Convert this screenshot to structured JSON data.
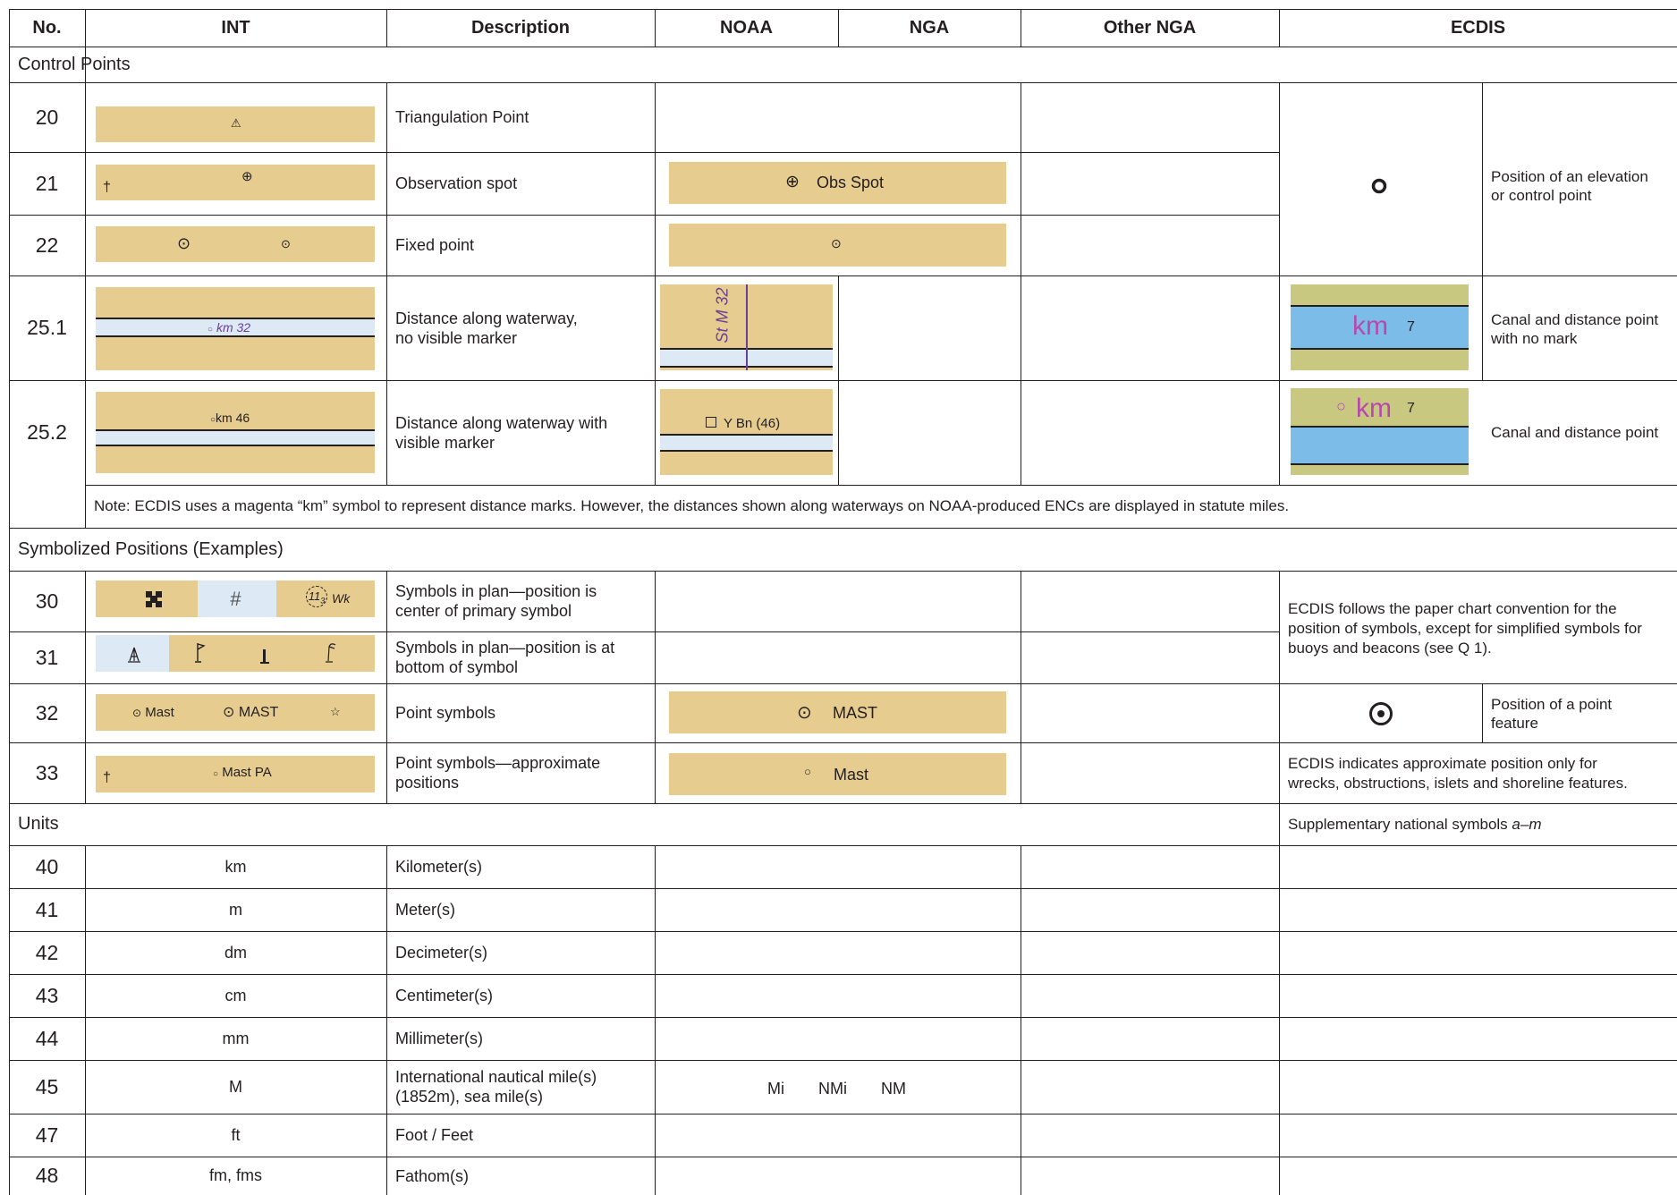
{
  "header": {
    "no": "No.",
    "int": "INT",
    "description": "Description",
    "noaa": "NOAA",
    "nga": "NGA",
    "other_nga": "Other NGA",
    "ecdis": "ECDIS"
  },
  "sections": {
    "control_points": "Control Points",
    "symbolized_positions": "Symbolized Positions (Examples)",
    "units": "Units"
  },
  "rows": {
    "r20": {
      "no": "20",
      "desc": "Triangulation Point",
      "int_symbol": "⚠"
    },
    "r21": {
      "no": "21",
      "desc": "Observation spot",
      "int_cross": "†",
      "int_symbol": "⊕",
      "noaa_symbol": "⊕",
      "noaa_text": "Obs Spot"
    },
    "r22": {
      "no": "22",
      "desc": "Fixed point",
      "int_symbol_a": "⊙",
      "int_symbol_b": "⊙",
      "noaa_symbol": "⊙"
    },
    "r25_1": {
      "no": "25.1",
      "desc_line1": "Distance along waterway,",
      "desc_line2": "no visible marker",
      "int_label": "km 32",
      "noaa_label": "St M 32",
      "ecdis_km": "km",
      "ecdis_num": "7",
      "ecdis_desc_line1": "Canal and distance point",
      "ecdis_desc_line2": "with no mark"
    },
    "r25_2": {
      "no": "25.2",
      "desc_line1": "Distance along waterway with",
      "desc_line2": "visible marker",
      "int_label": "km 46",
      "noaa_label": "Y Bn (46)",
      "ecdis_km": "km",
      "ecdis_num": "7",
      "ecdis_desc": "Canal and distance point"
    },
    "r30": {
      "no": "30",
      "desc_line1": "Symbols in plan—position is",
      "desc_line2": "center of primary symbol",
      "int_hash": "#",
      "int_wreck_num": "11",
      "int_wreck_sub": "3",
      "int_wreck_label": "Wk"
    },
    "r31": {
      "no": "31",
      "desc_line1": "Symbols in plan—position is at",
      "desc_line2": "bottom of symbol"
    },
    "r32": {
      "no": "32",
      "desc": "Point symbols",
      "int_mast_a": "Mast",
      "int_mast_b": "MAST",
      "int_star": "☆",
      "noaa_text": "MAST",
      "ecdis_desc_line1": "Position of a point",
      "ecdis_desc_line2": "feature"
    },
    "r33": {
      "no": "33",
      "desc_line1": "Point symbols—approximate",
      "desc_line2": "positions",
      "int_cross": "†",
      "int_label": "Mast  PA",
      "noaa_text": "Mast"
    }
  },
  "notes": {
    "km_note": "Note: ECDIS uses a magenta “km” symbol to represent distance marks. However, the distances shown along waterways on NOAA-produced ENCs are displayed in statute miles."
  },
  "ecdis_notes": {
    "position_elevation_line1": "Position of an elevation",
    "position_elevation_line2": "or control point",
    "symbols_line1": "ECDIS follows the paper chart convention for the",
    "symbols_line2": "position of symbols, except for simplified symbols for",
    "symbols_line3": "buoys and beacons (see Q 1).",
    "approx_line1": "ECDIS indicates approximate position only for",
    "approx_line2": "wrecks, obstructions, islets and shoreline features.",
    "supplementary_text": "Supplementary national symbols ",
    "supplementary_range": "a–m"
  },
  "units": [
    {
      "no": "40",
      "int": "km",
      "desc": "Kilometer(s)"
    },
    {
      "no": "41",
      "int": "m",
      "desc": "Meter(s)"
    },
    {
      "no": "42",
      "int": "dm",
      "desc": "Decimeter(s)"
    },
    {
      "no": "43",
      "int": "cm",
      "desc": "Centimeter(s)"
    },
    {
      "no": "44",
      "int": "mm",
      "desc": "Millimeter(s)"
    },
    {
      "no": "45",
      "int": "M",
      "desc_line1": "International nautical mile(s)",
      "desc_line2": "(1852m), sea mile(s)",
      "noaa_a": "Mi",
      "noaa_b": "NMi",
      "noaa_c": "NM"
    },
    {
      "no": "47",
      "int": "ft",
      "desc": "Foot / Feet"
    },
    {
      "no": "48",
      "int": "fm, fms",
      "desc": "Fathom(s)"
    }
  ],
  "colors": {
    "land_tan": "#e6cc8f",
    "water_light_blue": "#dde9f4",
    "ecdis_blue": "#7bbde8",
    "ecdis_olive": "#c8c881",
    "magenta": "#b848b0",
    "purple": "#6a3f94",
    "grid": "#231f20"
  }
}
